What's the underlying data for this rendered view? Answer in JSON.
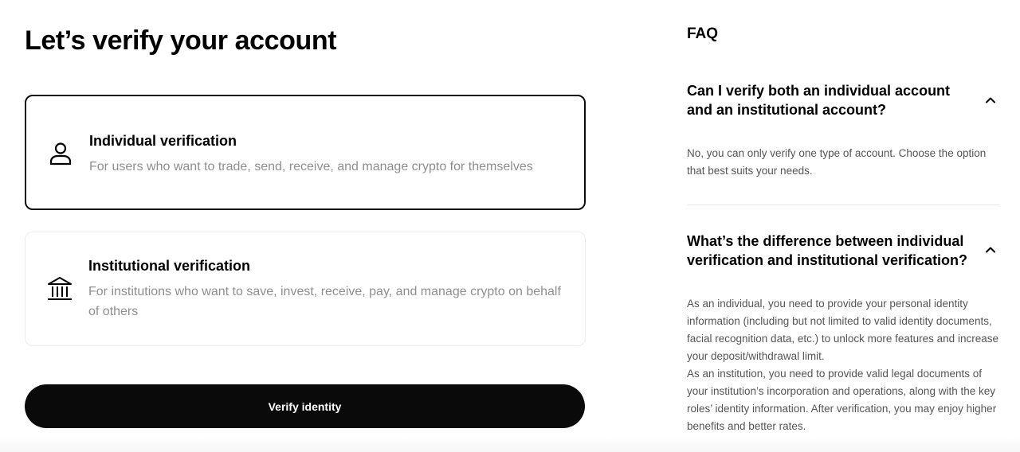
{
  "page": {
    "title": "Let’s verify your account"
  },
  "options": [
    {
      "title": "Individual verification",
      "description": "For users who want to trade, send, receive, and manage crypto for themselves",
      "icon": "person-icon",
      "selected": true
    },
    {
      "title": "Institutional verification",
      "description": "For institutions who want to save, invest, receive, pay, and manage crypto on behalf of others",
      "icon": "bank-icon",
      "selected": false
    }
  ],
  "verify_button": {
    "label": "Verify identity"
  },
  "faq": {
    "heading": "FAQ",
    "items": [
      {
        "question": "Can I verify both an individual account and an institutional account?",
        "answer": "No, you can only verify one type of account. Choose the option that best suits your needs.",
        "expanded": true
      },
      {
        "question": "What’s the difference between individual verification and institutional verification?",
        "answer": "As an individual, you need to provide your personal identity information (including but not limited to valid identity documents, facial recognition data, etc.) to unlock more features and increase your deposit/withdrawal limit.",
        "answer_2": "As an institution, you need to provide valid legal documents of your institution’s incorporation and operations, along with the key roles’ identity information. After verification, you may enjoy higher benefits and better rates.",
        "expanded": true
      }
    ]
  },
  "colors": {
    "primary": "#0a0a0a",
    "muted_text": "#8f8f8f",
    "answer_text": "#555555",
    "border": "#ececec"
  }
}
